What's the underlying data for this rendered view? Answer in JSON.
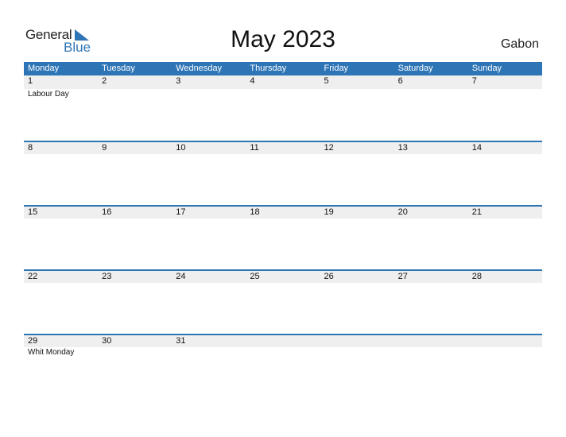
{
  "brand": {
    "general": "General",
    "blue": "Blue"
  },
  "title": "May 2023",
  "country": "Gabon",
  "colors": {
    "accent": "#2e75b6",
    "date_row_bg": "#efefef"
  },
  "weekdays": [
    "Monday",
    "Tuesday",
    "Wednesday",
    "Thursday",
    "Friday",
    "Saturday",
    "Sunday"
  ],
  "weeks": [
    {
      "dates": [
        "1",
        "2",
        "3",
        "4",
        "5",
        "6",
        "7"
      ],
      "events": [
        "Labour Day",
        "",
        "",
        "",
        "",
        "",
        ""
      ]
    },
    {
      "dates": [
        "8",
        "9",
        "10",
        "11",
        "12",
        "13",
        "14"
      ],
      "events": [
        "",
        "",
        "",
        "",
        "",
        "",
        ""
      ]
    },
    {
      "dates": [
        "15",
        "16",
        "17",
        "18",
        "19",
        "20",
        "21"
      ],
      "events": [
        "",
        "",
        "",
        "",
        "",
        "",
        ""
      ]
    },
    {
      "dates": [
        "22",
        "23",
        "24",
        "25",
        "26",
        "27",
        "28"
      ],
      "events": [
        "",
        "",
        "",
        "",
        "",
        "",
        ""
      ]
    },
    {
      "dates": [
        "29",
        "30",
        "31",
        "",
        "",
        "",
        ""
      ],
      "events": [
        "Whit Monday",
        "",
        "",
        "",
        "",
        "",
        ""
      ]
    }
  ]
}
